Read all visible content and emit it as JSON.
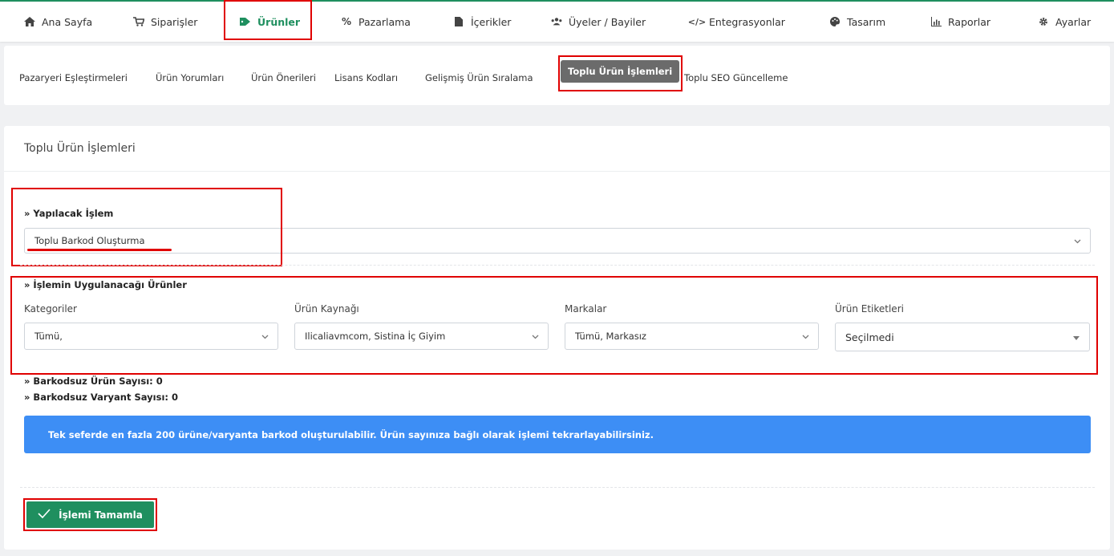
{
  "nav": {
    "items": [
      {
        "label": "Ana Sayfa",
        "icon": "home-icon"
      },
      {
        "label": "Siparişler",
        "icon": "cart-icon"
      },
      {
        "label": "Ürünler",
        "icon": "tag-icon"
      },
      {
        "label": "Pazarlama",
        "icon": "percent-icon"
      },
      {
        "label": "İçerikler",
        "icon": "file-icon"
      },
      {
        "label": "Üyeler / Bayiler",
        "icon": "users-icon"
      },
      {
        "label": "Entegrasyonlar",
        "icon": "code-icon"
      },
      {
        "label": "Tasarım",
        "icon": "palette-icon"
      },
      {
        "label": "Raporlar",
        "icon": "chart-icon"
      },
      {
        "label": "Ayarlar",
        "icon": "gear-icon"
      }
    ],
    "active": "Ürünler"
  },
  "subnav": {
    "items": [
      "Pazaryeri Eşleştirmeleri",
      "Ürün Yorumları",
      "Ürün Önerileri",
      "Lisans Kodları",
      "Gelişmiş Ürün Sıralama",
      "Toplu Ürün İşlemleri",
      "Toplu SEO Güncelleme"
    ],
    "active": "Toplu Ürün İşlemleri"
  },
  "panel": {
    "title": "Toplu Ürün İşlemleri",
    "operation": {
      "label": "» Yapılacak İşlem",
      "value": "Toplu Barkod Oluşturma"
    },
    "products_section": {
      "label": "» İşlemin Uygulanacağı Ürünler",
      "filters": [
        {
          "label": "Kategoriler",
          "value": "Tümü,"
        },
        {
          "label": "Ürün Kaynağı",
          "value": "Ilicaliavmcom, Sistina İç Giyim"
        },
        {
          "label": "Markalar",
          "value": "Tümü, Markasız"
        },
        {
          "label": "Ürün Etiketleri",
          "value": "Seçilmedi"
        }
      ]
    },
    "stats": {
      "no_barcode_products": "» Barkodsuz Ürün Sayısı: 0",
      "no_barcode_variants": "» Barkodsuz Varyant Sayısı: 0"
    },
    "info": "Tek seferde en fazla 200 ürüne/varyanta barkod oluşturulabilir. Ürün sayınıza bağlı olarak işlemi tekrarlayabilirsiniz.",
    "submit_label": "İşlemi Tamamla"
  },
  "colors": {
    "brand_green": "#1f8f5f",
    "info_blue": "#3d8ef5",
    "highlight_red": "#e00000"
  }
}
